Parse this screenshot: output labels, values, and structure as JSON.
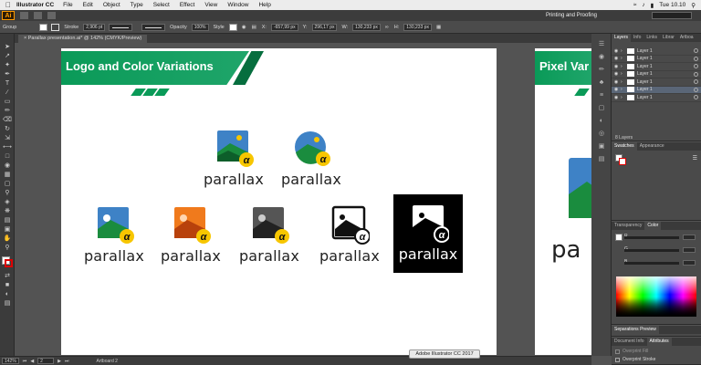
{
  "menubar": {
    "app_name": "Illustrator CC",
    "items": [
      "File",
      "Edit",
      "Object",
      "Type",
      "Select",
      "Effect",
      "View",
      "Window",
      "Help"
    ],
    "clock": "Tue 10.10"
  },
  "topbar": {
    "app_badge": "Ai",
    "workspace": "Printing and Proofing"
  },
  "control": {
    "selection": "Group",
    "stroke_label": "Stroke",
    "stroke_value": "2,906 pt",
    "profile": "Uniform",
    "brush": "Basic",
    "opacity_label": "Opacity",
    "opacity": "100%",
    "style_label": "Style",
    "x_label": "X:",
    "x": "-657,99 px",
    "y_label": "Y:",
    "y": "296,17 px",
    "w_label": "W:",
    "w": "130,233 px",
    "h_label": "H:",
    "h": "130,233 px"
  },
  "doc_tab": "Parallax presentation.ai* @ 142% (CMYK/Preview)",
  "artboard1": {
    "title": "Logo and Color Variations"
  },
  "artboard2": {
    "title": "Pixel Var",
    "word": "pa"
  },
  "logo_word": "parallax",
  "panels": {
    "layer_tabs": [
      "Layers",
      "Info",
      "Links",
      "Librar",
      "Artboa"
    ],
    "layers": [
      "Layer 1",
      "Layer 1",
      "Layer 1",
      "Layer 1",
      "Layer 1",
      "Layer 1",
      "Layer 1"
    ],
    "layer_count": "8 Layers",
    "swatch_tabs": [
      "Swatches",
      "Appearance"
    ],
    "color_tabs": [
      "Transparency",
      "Color"
    ],
    "channels": [
      "R",
      "G",
      "B"
    ],
    "separations": "Separations Preview",
    "doc_tabs": [
      "Document Info",
      "Attributes"
    ],
    "overprint_fill": "Overprint Fill",
    "overprint_stroke": "Overprint Stroke"
  },
  "status": {
    "zoom": "142%",
    "page": "2",
    "tool": "Artboard 2"
  },
  "tooltip": "Adobe Illustrator CC 2017",
  "colors": {
    "brand_green": "#0a9a58",
    "badge_yellow": "#f7c600"
  }
}
